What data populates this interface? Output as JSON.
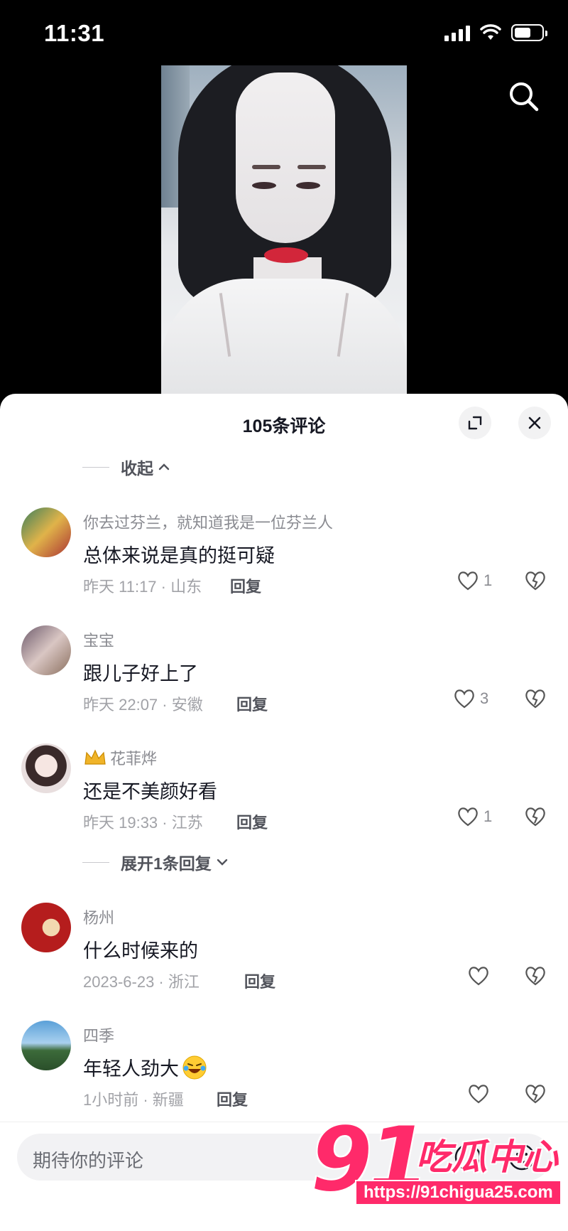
{
  "status_bar": {
    "time": "11:31"
  },
  "sheet": {
    "title": "105条评论",
    "collapse_label": "收起",
    "expand_label": "展开1条回复"
  },
  "comments": [
    {
      "user": "你去过芬兰，就知道我是一位芬兰人",
      "text": "总体来说是真的挺可疑",
      "meta": "昨天 11:17 · 山东",
      "reply": "回复",
      "likes": "1"
    },
    {
      "user": "宝宝",
      "text": "跟儿子好上了",
      "meta": "昨天 22:07 · 安徽",
      "reply": "回复",
      "likes": "3"
    },
    {
      "user": "花菲烨",
      "text": "还是不美颜好看",
      "meta": "昨天 19:33 · 江苏",
      "reply": "回复",
      "likes": "1"
    },
    {
      "user": "杨州",
      "text": "什么时候来的",
      "meta": "2023-6-23 · 浙江",
      "reply": "回复",
      "likes": ""
    },
    {
      "user": "四季",
      "text": "年轻人劲大",
      "meta": "1小时前 · 新疆",
      "reply": "回复",
      "likes": ""
    }
  ],
  "input": {
    "placeholder": "期待你的评论"
  },
  "watermark": {
    "number": "91",
    "brand": "吃瓜中心",
    "url": "https://91chigua25.com"
  },
  "colors": {
    "accent": "#ff2a6a",
    "text": "#161823",
    "muted": "#8a8b91"
  }
}
